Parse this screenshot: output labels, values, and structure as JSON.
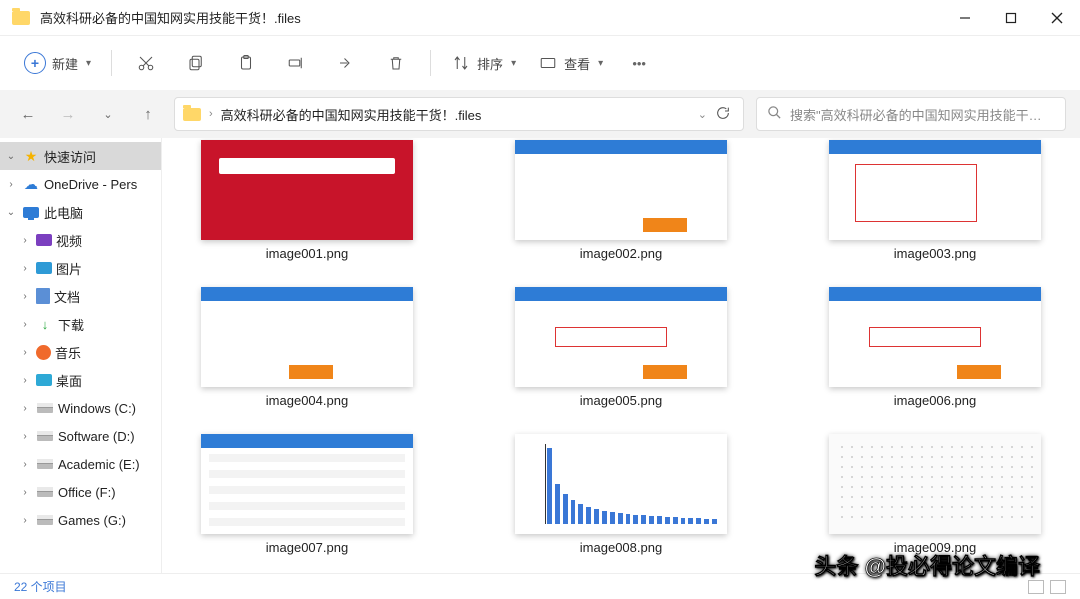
{
  "window": {
    "title": "高效科研必备的中国知网实用技能干货！.files"
  },
  "toolbar": {
    "new_label": "新建",
    "sort_label": "排序",
    "view_label": "查看"
  },
  "address": {
    "crumb_sep": "›",
    "path": "高效科研必备的中国知网实用技能干货！.files"
  },
  "search": {
    "placeholder": "搜索\"高效科研必备的中国知网实用技能干…"
  },
  "sidebar": {
    "quick_access": "快速访问",
    "onedrive": "OneDrive - Pers",
    "this_pc": "此电脑",
    "videos": "视频",
    "pictures": "图片",
    "documents": "文档",
    "downloads": "下载",
    "music": "音乐",
    "desktop": "桌面",
    "drive_c": "Windows (C:)",
    "drive_d": "Software (D:)",
    "drive_e": "Academic (E:)",
    "drive_f": "Office (F:)",
    "drive_g": "Games (G:)"
  },
  "files": {
    "f1": "image001.png",
    "f2": "image002.png",
    "f3": "image003.png",
    "f4": "image004.png",
    "f5": "image005.png",
    "f6": "image006.png",
    "f7": "image007.png",
    "f8": "image008.png",
    "f9": "image009.png"
  },
  "status": {
    "count": "22 个项目"
  },
  "watermark": "头条 @投必得论文编译"
}
